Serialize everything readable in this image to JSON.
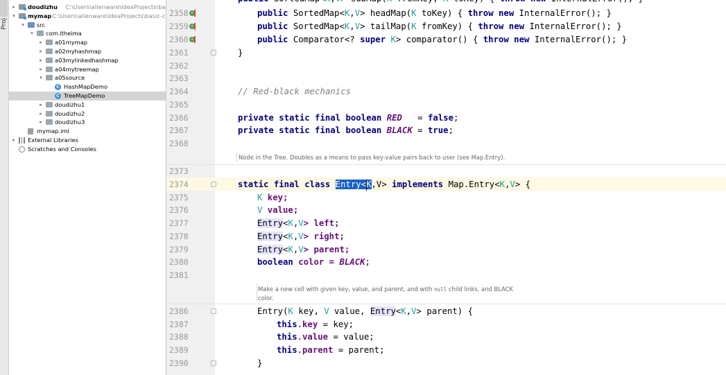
{
  "side_strip": {
    "label": "Proj"
  },
  "tree": [
    {
      "label": "doudizhu",
      "path": "C:\\Users\\alienware\\IdeaProjects\\basic-code",
      "icon": "module-folder-icon",
      "indent": 0,
      "arrow": "▸",
      "bold": true
    },
    {
      "label": "mymap",
      "path": "C:\\Users\\alienware\\IdeaProjects\\basic-code\\",
      "icon": "module-folder-icon",
      "indent": 0,
      "arrow": "▾",
      "bold": true
    },
    {
      "label": "src",
      "path": "",
      "icon": "source-folder-icon",
      "indent": 1,
      "arrow": "▾",
      "bold": false
    },
    {
      "label": "com.itheima",
      "path": "",
      "icon": "package-icon",
      "indent": 2,
      "arrow": "▾",
      "bold": false
    },
    {
      "label": "a01mymap",
      "path": "",
      "icon": "package-icon",
      "indent": 3,
      "arrow": "▸",
      "bold": false
    },
    {
      "label": "a02myhashmap",
      "path": "",
      "icon": "package-icon",
      "indent": 3,
      "arrow": "▸",
      "bold": false
    },
    {
      "label": "a03mylinkedhashmap",
      "path": "",
      "icon": "package-icon",
      "indent": 3,
      "arrow": "▸",
      "bold": false
    },
    {
      "label": "a04mytreemap",
      "path": "",
      "icon": "package-icon",
      "indent": 3,
      "arrow": "▸",
      "bold": false
    },
    {
      "label": "a05source",
      "path": "",
      "icon": "package-icon",
      "indent": 3,
      "arrow": "▾",
      "bold": false
    },
    {
      "label": "HashMapDemo",
      "path": "",
      "icon": "java-class-icon",
      "indent": 4,
      "arrow": "",
      "bold": false
    },
    {
      "label": "TreeMapDemo",
      "path": "",
      "icon": "java-class-icon",
      "indent": 4,
      "arrow": "",
      "bold": false,
      "selected": true
    },
    {
      "label": "doudizhu1",
      "path": "",
      "icon": "package-icon",
      "indent": 3,
      "arrow": "▸",
      "bold": false
    },
    {
      "label": "doudizhu2",
      "path": "",
      "icon": "package-icon",
      "indent": 3,
      "arrow": "▸",
      "bold": false
    },
    {
      "label": "doudizhu3",
      "path": "",
      "icon": "package-icon",
      "indent": 3,
      "arrow": "▸",
      "bold": false
    },
    {
      "label": "mymap.iml",
      "path": "",
      "icon": "iml-file-icon",
      "indent": 1,
      "arrow": "",
      "bold": false
    },
    {
      "label": "External Libraries",
      "path": "",
      "icon": "libraries-icon",
      "indent": 0,
      "arrow": "▸",
      "bold": false
    },
    {
      "label": "Scratches and Consoles",
      "path": "",
      "icon": "scratches-icon",
      "indent": 0,
      "arrow": "",
      "bold": false
    }
  ],
  "gutter": {
    "line_numbers": [
      "2358",
      "2359",
      "2360",
      "2361",
      "2362",
      "2363",
      "2364",
      "2365",
      "2366",
      "2367",
      "2368",
      "2373",
      "2374",
      "2375",
      "2376",
      "2377",
      "2378",
      "2379",
      "2380",
      "2381",
      "2386",
      "2387",
      "2388",
      "2389",
      "2390"
    ],
    "override_marker": "o"
  },
  "code": {
    "l2358": {
      "a": "public ",
      "b": "SortedMap",
      "c": "<",
      "d": "K",
      "e": ",",
      "f": "V",
      "g": "> headMap(",
      "h": "K",
      " i": "",
      "j": " toKey) { ",
      "k": "throw new ",
      "l": "InternalError(); }"
    },
    "l2358_text": [
      "public ",
      "SortedMap<",
      "K",
      ",",
      "V",
      "> headMap(",
      "K",
      " toKey) { ",
      "throw new ",
      "InternalError(); }"
    ],
    "l2359_text": [
      "public ",
      "SortedMap<",
      "K",
      ",",
      "V",
      "> tailMap(",
      "K",
      " fromKey) { ",
      "throw new ",
      "InternalError(); }"
    ],
    "l2360_text": [
      "public ",
      "Comparator<? ",
      "super ",
      "K",
      "> comparator() { ",
      "throw new ",
      "InternalError(); }"
    ],
    "l2361_text": "}",
    "l2364_text": "// Red-black mechanics",
    "l2366_text": [
      "private static final boolean ",
      "RED",
      "   = ",
      "false",
      ";"
    ],
    "l2367_text": [
      "private static final boolean ",
      "BLACK",
      " = ",
      "true",
      ";"
    ],
    "doc1": "Node in the Tree. Doubles as a means to pass key-value pairs back to user (see Map.Entry).",
    "l2374_text": [
      "static final class ",
      "Entry<K",
      ",",
      "V> ",
      "implements ",
      "Map.Entry<",
      "K",
      ",",
      "V",
      "> {"
    ],
    "l2375_text": [
      "K",
      " key;"
    ],
    "l2376_text": [
      "V",
      " value;"
    ],
    "l2377_text": [
      "Entry",
      "<",
      "K",
      ",",
      "V",
      "> left;"
    ],
    "l2378_text": [
      "Entry",
      "<",
      "K",
      ",",
      "V",
      "> right;"
    ],
    "l2379_text": [
      "Entry",
      "<",
      "K",
      ",",
      "V",
      "> parent;"
    ],
    "l2380_text": [
      "boolean ",
      "color = ",
      "BLACK",
      ";"
    ],
    "doc2_a": "Make a new cell with given key, value, and parent, and with ",
    "doc2_b": "null",
    "doc2_c": " child links, and BLACK color.",
    "l2386_text": [
      "Entry(",
      "K",
      " key, ",
      "V",
      " value, ",
      "Entry",
      "<",
      "K",
      ",",
      "V",
      "> parent) {"
    ],
    "l2387_text": [
      "this",
      ".",
      "key",
      " = key;"
    ],
    "l2388_text": [
      "this",
      ".",
      "value",
      " = value;"
    ],
    "l2389_text": [
      "this",
      ".",
      "parent",
      " = parent;"
    ],
    "l2390_text": "}"
  }
}
